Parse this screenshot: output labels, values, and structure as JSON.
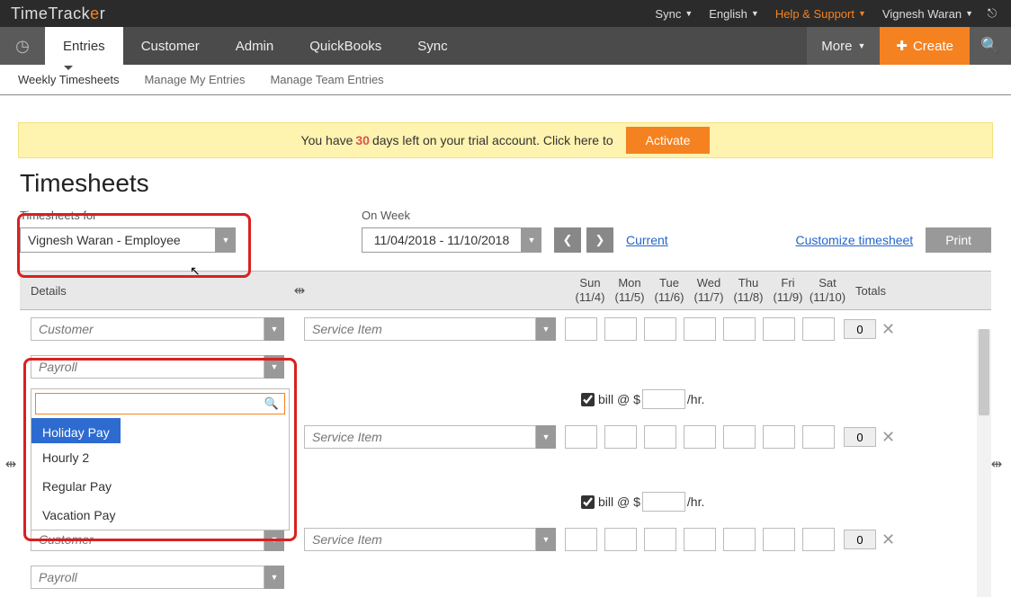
{
  "top": {
    "logo_a": "TimeTrack",
    "logo_b": "e",
    "logo_c": "r",
    "sync": "Sync",
    "lang": "English",
    "help": "Help & Support",
    "user": "Vignesh Waran"
  },
  "nav": {
    "entries": "Entries",
    "customer": "Customer",
    "admin": "Admin",
    "qb": "QuickBooks",
    "syncnav": "Sync",
    "more": "More",
    "create": "Create"
  },
  "subnav": {
    "weekly": "Weekly Timesheets",
    "mine": "Manage My Entries",
    "team": "Manage Team Entries"
  },
  "banner": {
    "pre": "You have",
    "days": "30",
    "post": "days left on your trial account. Click here to",
    "btn": "Activate"
  },
  "title": "Timesheets",
  "filter": {
    "for_label": "Timesheets for",
    "for_value": "Vignesh Waran - Employee",
    "week_label": "On Week",
    "week_value": "11/04/2018 - 11/10/2018",
    "current": "Current",
    "customize": "Customize timesheet",
    "print": "Print"
  },
  "grid": {
    "details": "Details",
    "days": [
      {
        "d": "Sun",
        "n": "(11/4)"
      },
      {
        "d": "Mon",
        "n": "(11/5)"
      },
      {
        "d": "Tue",
        "n": "(11/6)"
      },
      {
        "d": "Wed",
        "n": "(11/7)"
      },
      {
        "d": "Thu",
        "n": "(11/8)"
      },
      {
        "d": "Fri",
        "n": "(11/9)"
      },
      {
        "d": "Sat",
        "n": "(11/10)"
      }
    ],
    "totals": "Totals",
    "ph_customer": "Customer",
    "ph_service": "Service Item",
    "ph_payroll": "Payroll",
    "bill_pre": "bill @ $",
    "bill_post": "/hr.",
    "tot0": "0"
  },
  "dd": {
    "o1": "Holiday Pay",
    "o2": "Hourly 2",
    "o3": "Regular Pay",
    "o4": "Vacation Pay"
  }
}
